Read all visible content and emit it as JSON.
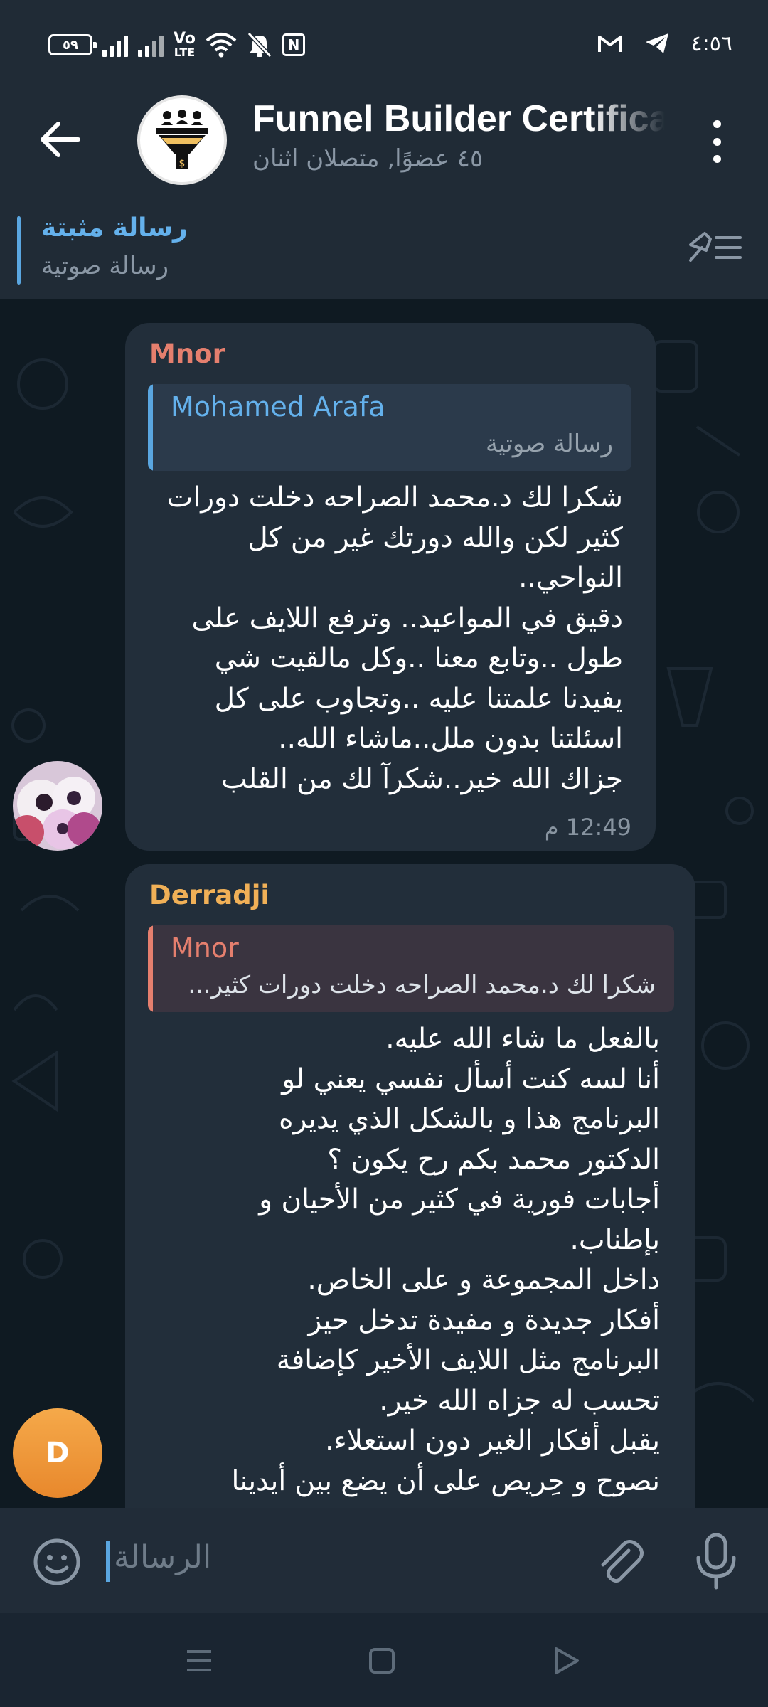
{
  "status_bar": {
    "battery": "٥٩",
    "network_label_top": "Vo",
    "network_label_bottom": "LTE",
    "nfc_label": "N",
    "time": "٤:٥٦",
    "icons": [
      "battery-icon",
      "signal-icon",
      "volte-icon",
      "wifi-icon",
      "mute-icon",
      "nfc-icon",
      "gmail-icon",
      "telegram-icon"
    ]
  },
  "header": {
    "title": "Funnel Builder Certificate",
    "subtitle": "٤٥ عضوًا, متصلان اثنان",
    "icons": [
      "back-arrow-icon",
      "group-avatar",
      "more-vert-icon"
    ]
  },
  "pinned": {
    "title": "رسالة مثبتة",
    "subtitle": "رسالة صوتية",
    "icon": "pinned-list-icon"
  },
  "messages": [
    {
      "sender": "Mnor",
      "sender_color": "#e57f6e",
      "reply": {
        "name": "Mohamed Arafa",
        "text": "رسالة صوتية",
        "color": "#64b1ec"
      },
      "lines": [
        "شكرا لك د.محمد الصراحه دخلت دورات",
        "كثير لكن والله دورتك غير من كل",
        "النواحي..",
        "دقيق في المواعيد.. وترفع اللايف على",
        "طول ..وتابع معنا ..وكل مالقيت شي",
        "يفيدنا علمتنا عليه ..وتجاوب على كل",
        "اسئلتنا بدون ملل..ماشاء الله..",
        "جزاك الله خير..شكرآ لك من القلب"
      ],
      "time": "12:49 م"
    },
    {
      "sender": "Derradji",
      "sender_color": "#f0b057",
      "avatar_letter": "D",
      "reply": {
        "name": "Mnor",
        "text": "شكرا لك د.محمد الصراحه دخلت دورات كثير...",
        "color": "#e57f6e"
      },
      "lines": [
        "بالفعل ما شاء الله عليه.",
        "أنا لسه كنت أسأل نفسي يعني لو",
        "البرنامج هذا و بالشكل الذي يديره",
        "الدكتور محمد بكم رح يكون ؟",
        "أجابات فورية في كثير من الأحيان و",
        "بإطناب.",
        "داخل المجموعة و على الخاص.",
        "أفكار جديدة و مفيدة تدخل حيز",
        "البرنامج مثل اللايف الأخير كإضافة",
        "تحسب له جزاه الله خير.",
        "يقبل أفكار الغير دون استعلاء.",
        "نصوح و حِريص على أن يضع بين أيدينا"
      ]
    }
  ],
  "input": {
    "placeholder": "الرسالة",
    "icons": [
      "emoji-icon",
      "attach-icon",
      "mic-icon"
    ]
  },
  "nav": {
    "icons": [
      "recents-icon",
      "home-icon",
      "back-icon"
    ]
  },
  "colors": {
    "background": "#0f1a22",
    "bar": "#202b36",
    "bubble": "#222e3a",
    "accent": "#5aa6e0"
  }
}
